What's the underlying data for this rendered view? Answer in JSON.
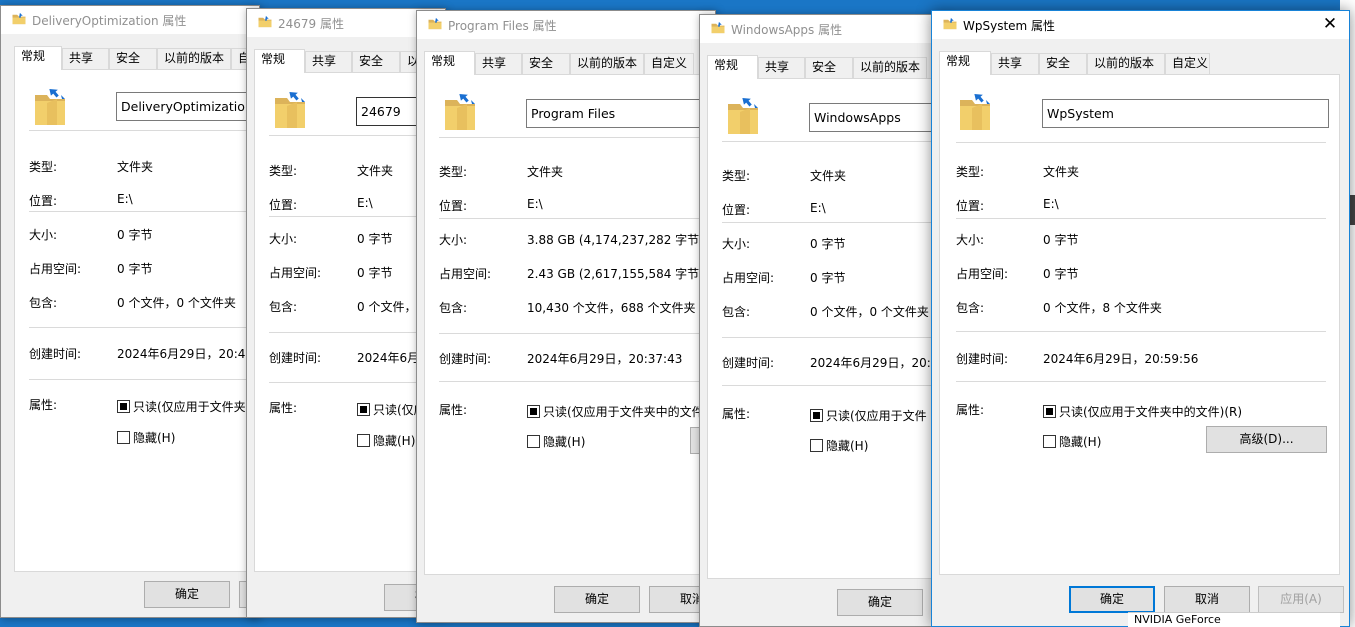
{
  "labels": {
    "type": "类型:",
    "location": "位置:",
    "size": "大小:",
    "size_on_disk": "占用空间:",
    "contains": "包含:",
    "created": "创建时间:",
    "attributes": "属性:"
  },
  "tabs": {
    "general": "常规",
    "sharing": "共享",
    "security": "安全",
    "previous_versions": "以前的版本",
    "customize": "自定义"
  },
  "buttons": {
    "ok": "确定",
    "cancel": "取消",
    "apply": "应用(A)",
    "advanced": "高级(D)...",
    "ok_partial": "确",
    "cancel_partial": "取"
  },
  "folder_icon": "folder-shortcut-icon",
  "taskbar_fragment": "NVIDIA GeForce",
  "dialogs": [
    {
      "title": "DeliveryOptimization 属性",
      "name": "DeliveryOptimization",
      "type": "文件夹",
      "location": "E:\\",
      "size": "0 字节",
      "size_on_disk": "0 字节",
      "contains": "0 个文件，0 个文件夹",
      "created": "2024年6月29日，20:47:",
      "readonly": "只读(仅应用于文件夹",
      "hidden": "隐藏(H)"
    },
    {
      "title": "24679 属性",
      "name": "24679",
      "type": "文件夹",
      "location": "E:\\",
      "size": "0 字节",
      "size_on_disk": "0 字节",
      "contains": "0 个文件，",
      "created": "2024年6月",
      "readonly": "只读(仅应",
      "hidden": "隐藏(H)"
    },
    {
      "title": "Program Files 属性",
      "name": "Program Files",
      "type": "文件夹",
      "location": "E:\\",
      "size": "3.88 GB (4,174,237,282 字节)",
      "size_on_disk": "2.43 GB (2,617,155,584 字节)",
      "contains": "10,430 个文件，688 个文件夹",
      "created": "2024年6月29日，20:37:43",
      "readonly": "只读(仅应用于文件夹中的文件",
      "hidden": "隐藏(H)"
    },
    {
      "title": "WindowsApps 属性",
      "name": "WindowsApps",
      "type": "文件夹",
      "location": "E:\\",
      "size": "0 字节",
      "size_on_disk": "0 字节",
      "contains": "0 个文件，0 个文件夹",
      "created": "2024年6月29日，20:4",
      "readonly": "只读(仅应用于文件",
      "hidden": "隐藏(H)"
    },
    {
      "title": "WpSystem 属性",
      "name": "WpSystem",
      "type": "文件夹",
      "location": "E:\\",
      "size": "0 字节",
      "size_on_disk": "0 字节",
      "contains": "0 个文件，8 个文件夹",
      "created": "2024年6月29日，20:59:56",
      "readonly": "只读(仅应用于文件夹中的文件)(R)",
      "hidden": "隐藏(H)"
    }
  ]
}
